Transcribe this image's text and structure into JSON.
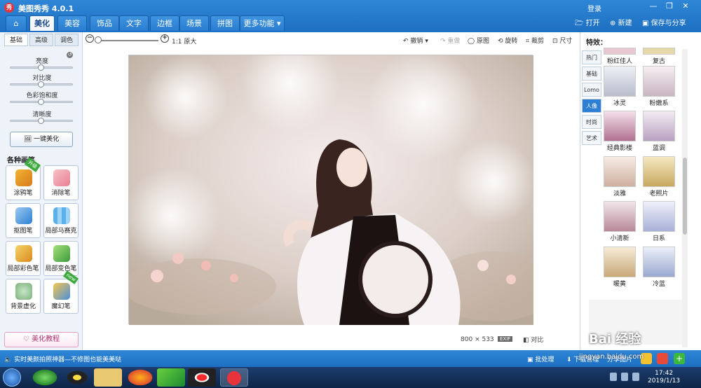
{
  "app": {
    "title": "美图秀秀 4.0.1",
    "login": "登录"
  },
  "main_tabs": [
    "美化",
    "美容",
    "饰品",
    "文字",
    "边框",
    "场景",
    "拼图",
    "更多功能"
  ],
  "top_actions": {
    "open": "打开",
    "new": "新建",
    "save_share": "保存与分享"
  },
  "sub_tabs": [
    "基础",
    "高级",
    "调色"
  ],
  "sliders": [
    {
      "label": "亮度",
      "value": 0.5
    },
    {
      "label": "对比度",
      "value": 0.5
    },
    {
      "label": "色彩饱和度",
      "value": 0.5
    },
    {
      "label": "清晰度",
      "value": 0.5
    }
  ],
  "one_key_label": "一键美化",
  "brushes_header": "各种画笔",
  "brushes": [
    {
      "label": "涂鸦笔",
      "badge": "升级"
    },
    {
      "label": "消除笔",
      "badge": ""
    },
    {
      "label": "抠图笔",
      "badge": ""
    },
    {
      "label": "局部马赛克",
      "badge": ""
    },
    {
      "label": "局部彩色笔",
      "badge": ""
    },
    {
      "label": "局部变色笔",
      "badge": ""
    },
    {
      "label": "背景虚化",
      "badge": ""
    },
    {
      "label": "魔幻笔",
      "badge": "new"
    }
  ],
  "tutorial_label": "美化教程",
  "canvas_toolbar": {
    "zoom_text": "1:1 原大",
    "undo": "撤销",
    "redo": "重做",
    "original": "原图",
    "rotate": "旋转",
    "crop": "裁剪",
    "size": "尺寸"
  },
  "image_info": {
    "width": "800",
    "sep": "×",
    "height": "533",
    "exif": "EXIF",
    "compare": "对比"
  },
  "effects_header": "特效：",
  "effect_categories": [
    "热门",
    "基础",
    "Lomo",
    "人像",
    "时尚",
    "艺术"
  ],
  "active_category": "人像",
  "effects": [
    "粉红佳人",
    "复古",
    "冰灵",
    "粉嫩系",
    "经典影楼",
    "蓝调",
    "淡雅",
    "老照片",
    "小清新",
    "日系",
    "暖黄",
    "冷蓝"
  ],
  "status": {
    "tip": "实时美颜拍照神器—不修图也能美美哒",
    "batch": "批处理",
    "download": "下载管理",
    "share_pic": "分享图片"
  },
  "clock": {
    "time": "17:42",
    "date": "2019/1/13"
  },
  "watermark": {
    "main": "Bai 经验",
    "sub": "jingyan.baidu.com"
  }
}
